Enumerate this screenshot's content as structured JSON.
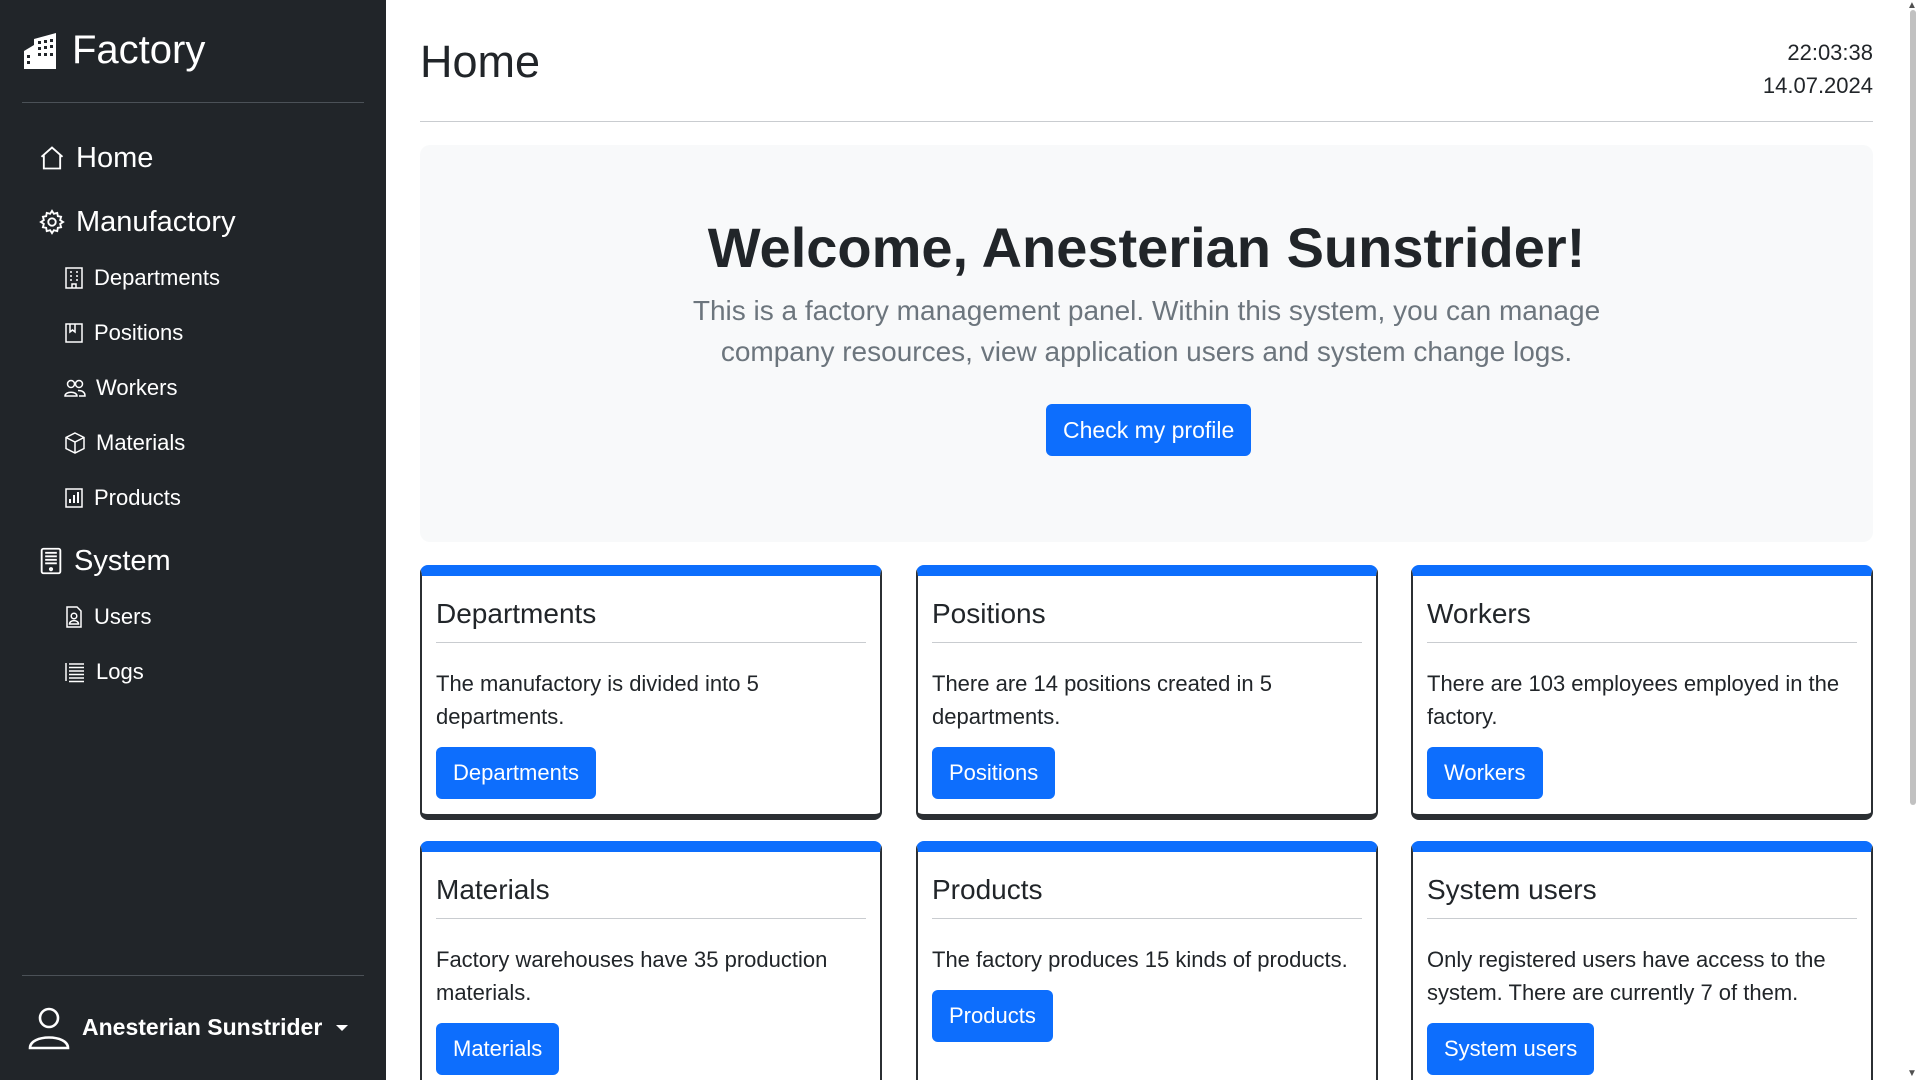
{
  "sidebar": {
    "brand": "Factory",
    "nav": {
      "home": "Home",
      "manufactory": "Manufactory",
      "departments": "Departments",
      "positions": "Positions",
      "workers": "Workers",
      "materials": "Materials",
      "products": "Products",
      "system": "System",
      "users": "Users",
      "logs": "Logs"
    },
    "user": "Anesterian Sunstrider"
  },
  "header": {
    "title": "Home",
    "time": "22:03:38",
    "date": "14.07.2024"
  },
  "hero": {
    "heading": "Welcome, Anesterian Sunstrider!",
    "text": "This is a factory management panel. Within this system, you can manage company resources, view application users and system change logs.",
    "button": "Check my profile"
  },
  "cards": [
    {
      "title": "Departments",
      "text": "The manufactory is divided into 5 departments.",
      "button": "Departments"
    },
    {
      "title": "Positions",
      "text": "There are 14 positions created in 5 departments.",
      "button": "Positions"
    },
    {
      "title": "Workers",
      "text": "There are 103 employees employed in the factory.",
      "button": "Workers"
    },
    {
      "title": "Materials",
      "text": "Factory warehouses have 35 production materials.",
      "button": "Materials"
    },
    {
      "title": "Products",
      "text": "The factory produces 15 kinds of products.",
      "button": "Products"
    },
    {
      "title": "System users",
      "text": "Only registered users have access to the system. There are currently 7 of them.",
      "button": "System users"
    }
  ],
  "colors": {
    "sidebar_bg": "#212529",
    "accent": "#0d6efd",
    "hero_bg": "#f8f9fa"
  },
  "icons": {
    "brand": "building-icon",
    "home": "house-icon",
    "manufactory": "gear-icon",
    "departments": "building-small-icon",
    "positions": "clipboard-icon",
    "workers": "people-icon",
    "materials": "box-icon",
    "products": "bar-chart-icon",
    "system": "device-icon",
    "users": "person-badge-icon",
    "logs": "list-icon",
    "user": "person-icon"
  }
}
